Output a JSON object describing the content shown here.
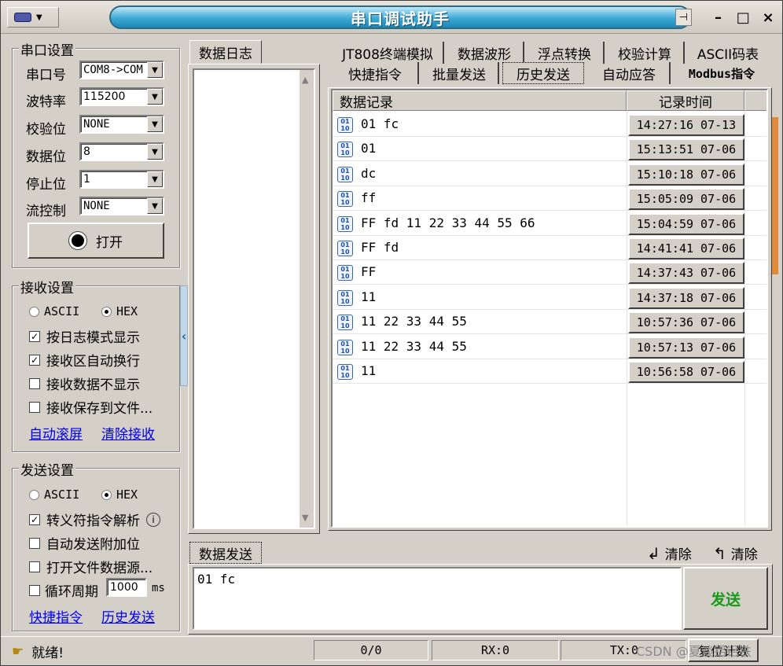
{
  "window": {
    "title": "串口调试助手"
  },
  "port_settings": {
    "title": "串口设置",
    "port_label": "串口号",
    "port_value": "COM8->COM",
    "baud_label": "波特率",
    "baud_value": "115200",
    "parity_label": "校验位",
    "parity_value": "NONE",
    "databits_label": "数据位",
    "databits_value": "8",
    "stopbits_label": "停止位",
    "stopbits_value": "1",
    "flow_label": "流控制",
    "flow_value": "NONE",
    "open_label": "打开"
  },
  "receive_settings": {
    "title": "接收设置",
    "ascii_label": "ASCII",
    "hex_label": "HEX",
    "mode": "HEX",
    "log_mode_label": "按日志模式显示",
    "log_mode_checked": true,
    "auto_wrap_label": "接收区自动换行",
    "auto_wrap_checked": true,
    "hide_data_label": "接收数据不显示",
    "hide_data_checked": false,
    "save_file_label": "接收保存到文件...",
    "save_file_checked": false,
    "auto_scroll_link": "自动滚屏",
    "clear_link": "清除接收"
  },
  "send_settings": {
    "title": "发送设置",
    "ascii_label": "ASCII",
    "hex_label": "HEX",
    "mode": "HEX",
    "escape_label": "转义符指令解析",
    "escape_checked": true,
    "append_label": "自动发送附加位",
    "append_checked": false,
    "file_source_label": "打开文件数据源...",
    "file_source_checked": false,
    "cycle_label": "循环周期",
    "cycle_checked": false,
    "cycle_value": "1000",
    "cycle_unit": "ms",
    "shortcut_link": "快捷指令",
    "history_link": "历史发送"
  },
  "log_pane": {
    "tab_label": "数据日志"
  },
  "tabs": {
    "row1": [
      "JT808终端模拟",
      "数据波形",
      "浮点转换",
      "校验计算",
      "ASCII码表"
    ],
    "row2": [
      "快捷指令",
      "批量发送",
      "历史发送",
      "自动应答",
      "Modbus指令"
    ],
    "active": "历史发送"
  },
  "history_table": {
    "col_data": "数据记录",
    "col_time": "记录时间",
    "rows": [
      {
        "data": "01 fc",
        "time": "14:27:16 07-13"
      },
      {
        "data": "01",
        "time": "15:13:51 07-06"
      },
      {
        "data": "dc",
        "time": "15:10:18 07-06"
      },
      {
        "data": "ff",
        "time": "15:05:09 07-06"
      },
      {
        "data": "FF fd 11 22 33 44 55 66",
        "time": "15:04:59 07-06"
      },
      {
        "data": "FF fd",
        "time": "14:41:41 07-06"
      },
      {
        "data": "FF",
        "time": "14:37:43 07-06"
      },
      {
        "data": "11",
        "time": "14:37:18 07-06"
      },
      {
        "data": "11 22 33 44 55",
        "time": "10:57:36 07-06"
      },
      {
        "data": "11 22 33 44 55",
        "time": "10:57:13 07-06"
      },
      {
        "data": "11",
        "time": "10:56:58 07-06"
      }
    ]
  },
  "send_area": {
    "tab_label": "数据发送",
    "clear_label_1": "清除",
    "clear_label_2": "清除",
    "text": "01 fc",
    "send_label": "发送"
  },
  "status": {
    "ready": "就绪!",
    "counter": "0/0",
    "rx": "RX:0",
    "tx": "TX:0",
    "reset": "复位计数"
  },
  "watermark": "CSDN @夏谈铝铝铁",
  "colors": {
    "title_accent": "#1c88b8",
    "send_button": "#1a9a1a",
    "link": "#0000ee"
  }
}
